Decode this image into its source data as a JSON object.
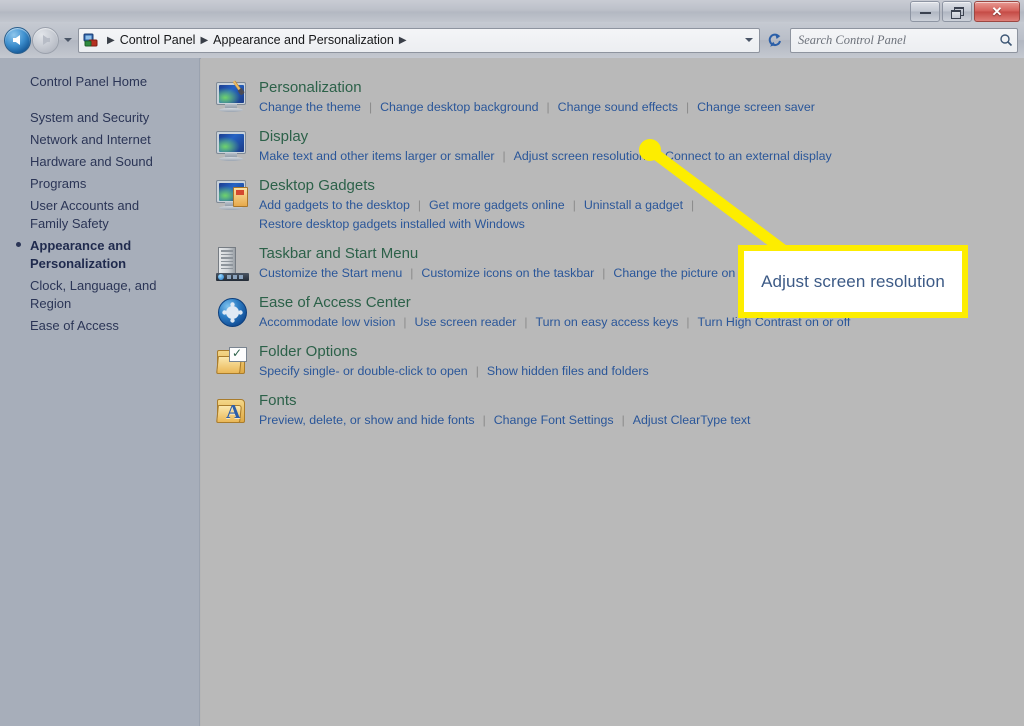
{
  "window": {
    "buttons": {
      "minimize": "Minimize",
      "restore": "Restore",
      "close": "Close"
    }
  },
  "navigation": {
    "back_label": "Back",
    "forward_label": "Forward",
    "recent_pages_label": "Recent pages",
    "refresh_label": "Refresh",
    "breadcrumb": [
      "Control Panel",
      "Appearance and Personalization"
    ],
    "breadcrumb_separator": "▶",
    "address_dropdown_label": "Previous locations"
  },
  "search": {
    "placeholder": "Search Control Panel",
    "value": "",
    "icon": "search-icon"
  },
  "sidebar": {
    "home": "Control Panel Home",
    "items": [
      {
        "label": "System and Security",
        "current": false
      },
      {
        "label": "Network and Internet",
        "current": false
      },
      {
        "label": "Hardware and Sound",
        "current": false
      },
      {
        "label": "Programs",
        "current": false
      },
      {
        "label": "User Accounts and Family Safety",
        "current": false
      },
      {
        "label": "Appearance and Personalization",
        "current": true
      },
      {
        "label": "Clock, Language, and Region",
        "current": false
      },
      {
        "label": "Ease of Access",
        "current": false
      }
    ]
  },
  "categories": [
    {
      "title": "Personalization",
      "icon": "personalization-icon",
      "links": [
        "Change the theme",
        "Change desktop background",
        "Change sound effects",
        "Change screen saver"
      ],
      "links_row2": []
    },
    {
      "title": "Display",
      "icon": "display-icon",
      "links": [
        "Make text and other items larger or smaller",
        "Adjust screen resolution",
        "Connect to an external display"
      ],
      "links_row2": []
    },
    {
      "title": "Desktop Gadgets",
      "icon": "desktop-gadgets-icon",
      "links": [
        "Add gadgets to the desktop",
        "Get more gadgets online",
        "Uninstall a gadget"
      ],
      "links_row2": [
        "Restore desktop gadgets installed with Windows"
      ]
    },
    {
      "title": "Taskbar and Start Menu",
      "icon": "taskbar-start-menu-icon",
      "links": [
        "Customize the Start menu",
        "Customize icons on the taskbar",
        "Change the picture on the Start menu"
      ],
      "links_row2": []
    },
    {
      "title": "Ease of Access Center",
      "icon": "ease-of-access-icon",
      "links": [
        "Accommodate low vision",
        "Use screen reader",
        "Turn on easy access keys",
        "Turn High Contrast on or off"
      ],
      "links_row2": []
    },
    {
      "title": "Folder Options",
      "icon": "folder-options-icon",
      "links": [
        "Specify single- or double-click to open",
        "Show hidden files and folders"
      ],
      "links_row2": []
    },
    {
      "title": "Fonts",
      "icon": "fonts-icon",
      "links": [
        "Preview, delete, or show and hide fonts",
        "Change Font Settings",
        "Adjust ClearType text"
      ],
      "links_row2": []
    }
  ],
  "callout": {
    "text": "Adjust screen resolution",
    "highlight_color": "#fded00",
    "text_color": "#3c5a86"
  },
  "colors": {
    "sidebar_bg": "#a7aeba",
    "content_bg": "#b9b9b9",
    "heading": "#2c6149",
    "link": "#2a5699",
    "sidebar_text": "#2b3556"
  }
}
